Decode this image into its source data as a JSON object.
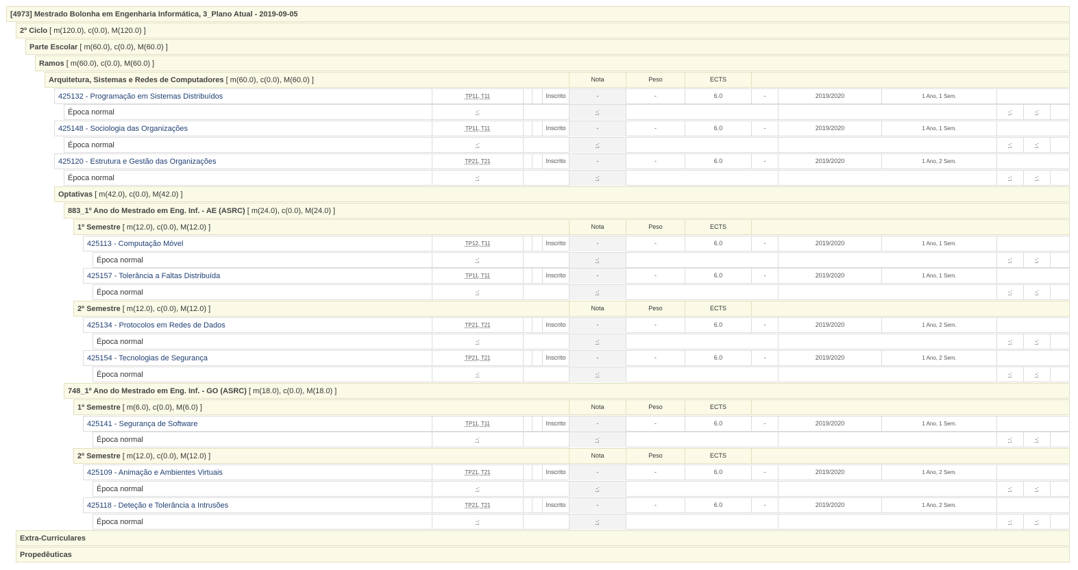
{
  "plan_title": "[4973] Mestrado Bolonha em Engenharia Informática, 3_Plano Atual - 2019-09-05",
  "columns": {
    "nota": "Nota",
    "peso": "Peso",
    "ects": "ECTS"
  },
  "rows": [
    {
      "kind": "group",
      "level": 0,
      "name": "[4973] Mestrado Bolonha em Engenharia Informática, 3_Plano Atual - 2019-09-05",
      "extra": ""
    },
    {
      "kind": "group",
      "level": 1,
      "name": "2º Ciclo",
      "extra": " [ m(120.0), c(0.0), M(120.0) ]"
    },
    {
      "kind": "group",
      "level": 2,
      "name": "Parte Escolar",
      "extra": " [ m(60.0), c(0.0), M(60.0) ]"
    },
    {
      "kind": "group",
      "level": 3,
      "name": "Ramos",
      "extra": " [ m(60.0), c(0.0), M(60.0) ]"
    },
    {
      "kind": "group",
      "level": 4,
      "name": "Arquitetura, Sistemas e Redes de Computadores",
      "extra": " [ m(60.0), c(0.0), M(60.0) ]",
      "header": true
    },
    {
      "kind": "course",
      "level": 5,
      "name": "425132 - Programação em Sistemas Distribuídos",
      "turmas": "TP11, T11",
      "state": "Inscrito",
      "nota": "-",
      "peso": "-",
      "ects": "6.0",
      "dash": "-",
      "year": "2019/2020",
      "period": "1 Ano, 1 Sem."
    },
    {
      "kind": "epoca",
      "level": 6,
      "name": "Época normal",
      "c1": "-:",
      "c2": "-:",
      "c3": "-:",
      "c4": "-:"
    },
    {
      "kind": "course",
      "level": 5,
      "name": "425148 - Sociologia das Organizações",
      "turmas": "TP11, T11",
      "state": "Inscrito",
      "nota": "-",
      "peso": "-",
      "ects": "6.0",
      "dash": "-",
      "year": "2019/2020",
      "period": "1 Ano, 1 Sem."
    },
    {
      "kind": "epoca",
      "level": 6,
      "name": "Época normal",
      "c1": "-:",
      "c2": "-:",
      "c3": "-:",
      "c4": "-:"
    },
    {
      "kind": "course",
      "level": 5,
      "name": "425120 - Estrutura e Gestão das Organizações",
      "turmas": "TP21, T21",
      "state": "Inscrito",
      "nota": "-",
      "peso": "-",
      "ects": "6.0",
      "dash": "-",
      "year": "2019/2020",
      "period": "1 Ano, 2 Sem."
    },
    {
      "kind": "epoca",
      "level": 6,
      "name": "Época normal",
      "c1": "-:",
      "c2": "-:",
      "c3": "-:",
      "c4": "-:"
    },
    {
      "kind": "group",
      "level": 5,
      "name": "Optativas",
      "extra": " [ m(42.0), c(0.0), M(42.0) ]"
    },
    {
      "kind": "group",
      "level": 6,
      "name": "883_1º Ano do Mestrado em Eng. Inf. - AE (ASRC)",
      "extra": " [ m(24.0), c(0.0), M(24.0) ]"
    },
    {
      "kind": "group",
      "level": 7,
      "name": "1º Semestre",
      "extra": " [ m(12.0), c(0.0), M(12.0) ]",
      "header": true
    },
    {
      "kind": "course",
      "level": 8,
      "name": "425113 - Computação Móvel",
      "turmas": "TP12, T11",
      "state": "Inscrito",
      "nota": "-",
      "peso": "-",
      "ects": "6.0",
      "dash": "-",
      "year": "2019/2020",
      "period": "1 Ano, 1 Sem."
    },
    {
      "kind": "epoca",
      "level": 9,
      "name": "Época normal",
      "c1": "-:",
      "c2": "-:",
      "c3": "-:",
      "c4": "-:"
    },
    {
      "kind": "course",
      "level": 8,
      "name": "425157 - Tolerância a Faltas Distribuída",
      "turmas": "TP11, T11",
      "state": "Inscrito",
      "nota": "-",
      "peso": "-",
      "ects": "6.0",
      "dash": "-",
      "year": "2019/2020",
      "period": "1 Ano, 1 Sem."
    },
    {
      "kind": "epoca",
      "level": 9,
      "name": "Época normal",
      "c1": "-:",
      "c2": "-:",
      "c3": "-:",
      "c4": "-:"
    },
    {
      "kind": "group",
      "level": 7,
      "name": "2º Semestre",
      "extra": " [ m(12.0), c(0.0), M(12.0) ]",
      "header": true
    },
    {
      "kind": "course",
      "level": 8,
      "name": "425134 - Protocolos em Redes de Dados",
      "turmas": "TP21, T21",
      "state": "Inscrito",
      "nota": "-",
      "peso": "-",
      "ects": "6.0",
      "dash": "-",
      "year": "2019/2020",
      "period": "1 Ano, 2 Sem."
    },
    {
      "kind": "epoca",
      "level": 9,
      "name": "Época normal",
      "c1": "-:",
      "c2": "-:",
      "c3": "-:",
      "c4": "-:"
    },
    {
      "kind": "course",
      "level": 8,
      "name": "425154 - Tecnologias de Segurança",
      "turmas": "TP21, T21",
      "state": "Inscrito",
      "nota": "-",
      "peso": "-",
      "ects": "6.0",
      "dash": "-",
      "year": "2019/2020",
      "period": "1 Ano, 2 Sem."
    },
    {
      "kind": "epoca",
      "level": 9,
      "name": "Época normal",
      "c1": "-:",
      "c2": "-:",
      "c3": "-:",
      "c4": "-:"
    },
    {
      "kind": "group",
      "level": 6,
      "name": "748_1º Ano do Mestrado em Eng. Inf. - GO (ASRC)",
      "extra": " [ m(18.0), c(0.0), M(18.0) ]"
    },
    {
      "kind": "group",
      "level": 7,
      "name": "1º Semestre",
      "extra": " [ m(6.0), c(0.0), M(6.0) ]",
      "header": true
    },
    {
      "kind": "course",
      "level": 8,
      "name": "425141 - Segurança de Software",
      "turmas": "TP11, T11",
      "state": "Inscrito",
      "nota": "-",
      "peso": "-",
      "ects": "6.0",
      "dash": "-",
      "year": "2019/2020",
      "period": "1 Ano, 1 Sem."
    },
    {
      "kind": "epoca",
      "level": 9,
      "name": "Época normal",
      "c1": "-:",
      "c2": "-:",
      "c3": "-:",
      "c4": "-:"
    },
    {
      "kind": "group",
      "level": 7,
      "name": "2º Semestre",
      "extra": " [ m(12.0), c(0.0), M(12.0) ]",
      "header": true
    },
    {
      "kind": "course",
      "level": 8,
      "name": "425109 - Animação e Ambientes Virtuais",
      "turmas": "TP21, T21",
      "state": "Inscrito",
      "nota": "-",
      "peso": "-",
      "ects": "6.0",
      "dash": "-",
      "year": "2019/2020",
      "period": "1 Ano, 2 Sem."
    },
    {
      "kind": "epoca",
      "level": 9,
      "name": "Época normal",
      "c1": "-:",
      "c2": "-:",
      "c3": "-:",
      "c4": "-:"
    },
    {
      "kind": "course",
      "level": 8,
      "name": "425118 - Deteção e Tolerância a Intrusões",
      "turmas": "TP21, T21",
      "state": "Inscrito",
      "nota": "-",
      "peso": "-",
      "ects": "6.0",
      "dash": "-",
      "year": "2019/2020",
      "period": "1 Ano, 2 Sem."
    },
    {
      "kind": "epoca",
      "level": 9,
      "name": "Época normal",
      "c1": "-:",
      "c2": "-:",
      "c3": "-:",
      "c4": "-:"
    },
    {
      "kind": "group",
      "level": 1,
      "name": "Extra-Curriculares",
      "extra": ""
    },
    {
      "kind": "group",
      "level": 1,
      "name": "Propedêuticas",
      "extra": ""
    }
  ]
}
